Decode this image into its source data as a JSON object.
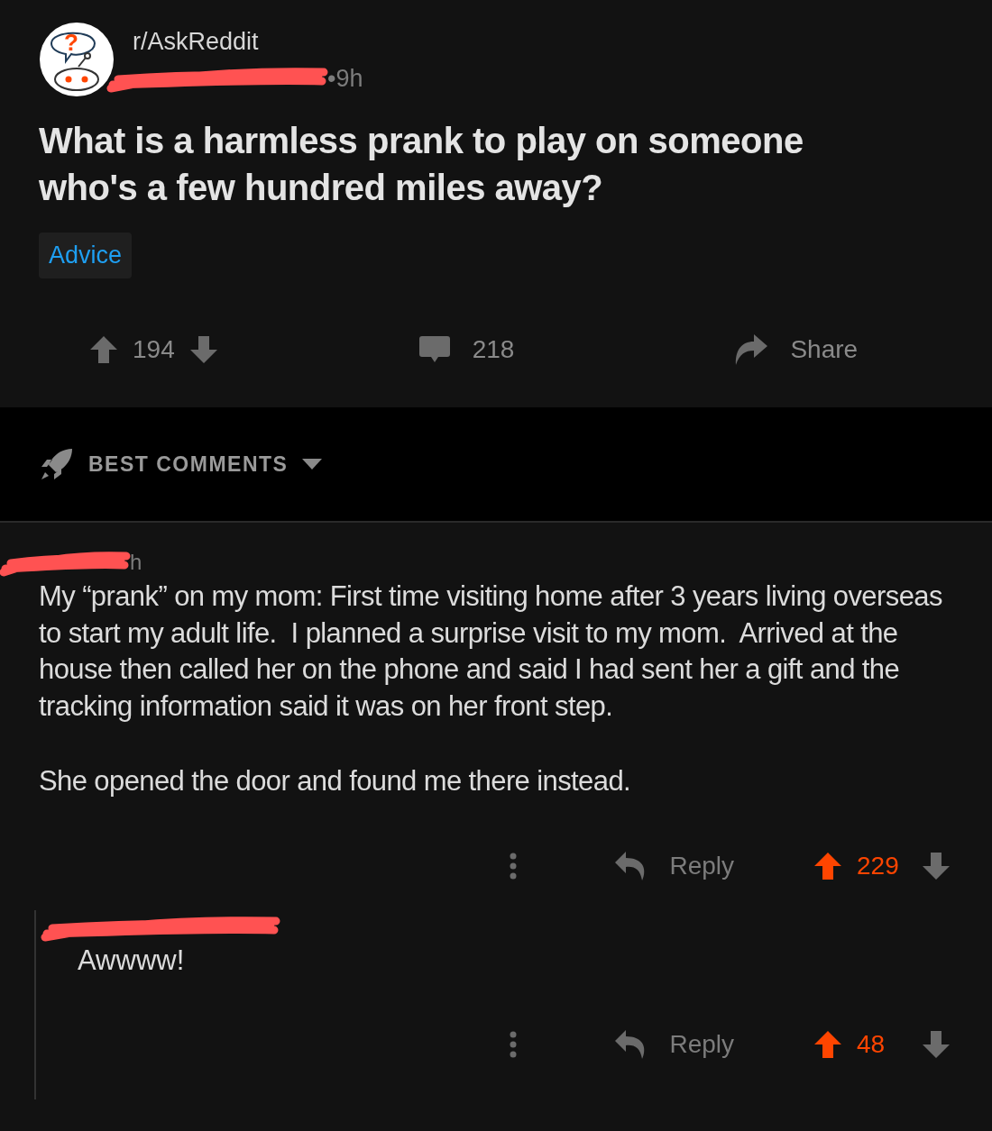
{
  "post": {
    "avatar_glyph": "?",
    "subreddit": "r/AskReddit",
    "time": "•9h",
    "title": "What is a harmless prank to play on someone who's a few hundred miles away?",
    "flair": "Advice",
    "score": "194",
    "upvoted": false,
    "comments": "218",
    "share": "Share"
  },
  "sort": {
    "label": "BEST COMMENTS"
  },
  "comments": [
    {
      "time": "h",
      "body": [
        "My “prank” on my mom: First time visiting home after 3 years living overseas to start my adult life.  I planned a surprise visit to my mom.  Arrived at the house then called her on the phone and said I had sent her a gift and the tracking information said it was on her front step.",
        "She opened the door and found me there instead."
      ],
      "reply": "Reply",
      "score": "229",
      "upvoted": true,
      "children": [
        {
          "body": [
            "Awwww!"
          ],
          "reply": "Reply",
          "score": "48",
          "upvoted": true
        }
      ]
    }
  ]
}
